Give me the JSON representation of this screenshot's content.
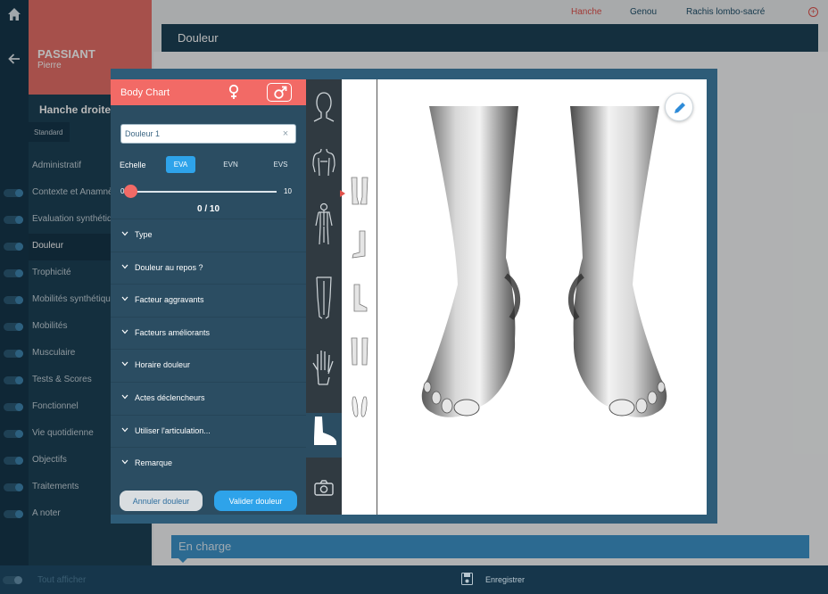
{
  "patient": {
    "last_name": "PASSIANT",
    "first_name": "Pierre"
  },
  "sidebar": {
    "title": "Hanche droite",
    "tab": "Standard",
    "items": [
      {
        "label": "Administratif"
      },
      {
        "label": "Contexte et Anamnèse"
      },
      {
        "label": "Evaluation synthétique"
      },
      {
        "label": "Douleur"
      },
      {
        "label": "Trophicité"
      },
      {
        "label": "Mobilités synthétiques"
      },
      {
        "label": "Mobilités"
      },
      {
        "label": "Musculaire"
      },
      {
        "label": "Tests & Scores"
      },
      {
        "label": "Fonctionnel"
      },
      {
        "label": "Vie quotidienne"
      },
      {
        "label": "Objectifs"
      },
      {
        "label": "Traitements"
      },
      {
        "label": "A noter"
      }
    ]
  },
  "topnav": {
    "items": [
      "Hanche",
      "Genou",
      "Rachis lombo-sacré"
    ],
    "active": "Hanche"
  },
  "main": {
    "section_title": "Douleur",
    "encharge": "En charge"
  },
  "footer": {
    "show_all": "Tout afficher",
    "save": "Enregistrer"
  },
  "modal": {
    "title": "Body Chart",
    "name_value": "Douleur 1",
    "scale_label": "Echelle",
    "scales": [
      "EVA",
      "EVN",
      "EVS"
    ],
    "active_scale": "EVA",
    "slider": {
      "min": "0",
      "max": "10",
      "value": 0,
      "max_value": 10,
      "display": "0 / 10"
    },
    "sections": [
      "Type",
      "Douleur au repos ?",
      "Facteur aggravants",
      "Facteurs améliorants",
      "Horaire douleur",
      "Actes déclencheurs",
      "Utiliser l'articulation...",
      "Remarque"
    ],
    "cancel_label": "Annuler douleur",
    "validate_label": "Valider douleur",
    "body_parts": [
      "head-icon",
      "torso-icon",
      "full-body-icon",
      "legs-icon",
      "hand-icon",
      "foot-icon",
      "camera-icon"
    ],
    "active_body_part": "foot-icon"
  },
  "colors": {
    "accent": "#f26a66",
    "primary": "#2ea3ea",
    "sidebar": "#1d4257",
    "dark": "#16364b"
  }
}
